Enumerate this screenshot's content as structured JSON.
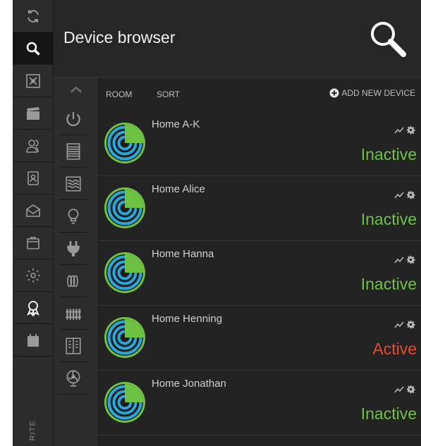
{
  "header": {
    "title": "Device browser"
  },
  "nav": {
    "items": [
      {
        "icon": "sync-icon"
      },
      {
        "icon": "search-icon",
        "active": true
      },
      {
        "icon": "crosshair-icon"
      },
      {
        "icon": "clapperboard-icon"
      },
      {
        "icon": "users-icon"
      },
      {
        "icon": "contacts-icon"
      },
      {
        "icon": "mail-icon"
      },
      {
        "icon": "folder-icon"
      },
      {
        "icon": "gear-icon"
      },
      {
        "icon": "award-icon"
      },
      {
        "icon": "calendar-icon"
      }
    ],
    "vertical_label": "RITE"
  },
  "categories": [
    {
      "icon": "chevron-up-icon"
    },
    {
      "icon": "power-icon"
    },
    {
      "icon": "blinds-icon"
    },
    {
      "icon": "heating-icon"
    },
    {
      "icon": "bulb-icon"
    },
    {
      "icon": "plug-icon"
    },
    {
      "icon": "coil-icon"
    },
    {
      "icon": "radiator-icon"
    },
    {
      "icon": "window-icon"
    },
    {
      "icon": "fan-icon"
    }
  ],
  "list": {
    "room_label": "ROOM",
    "sort_label": "SORT",
    "add_label": "ADD NEW DEVICE",
    "devices": [
      {
        "name": "Home A-K",
        "status": "Inactive",
        "status_color": "#6dc243"
      },
      {
        "name": "Home Alice",
        "status": "Inactive",
        "status_color": "#6dc243"
      },
      {
        "name": "Home Hanna",
        "status": "Inactive",
        "status_color": "#6dc243"
      },
      {
        "name": "Home Henning",
        "status": "Active",
        "status_color": "#e84a2a"
      },
      {
        "name": "Home Jonathan",
        "status": "Inactive",
        "status_color": "#6dc243"
      }
    ]
  },
  "colors": {
    "accent_green": "#6dc243",
    "accent_blue": "#2aa7d8",
    "active_red": "#e84a2a"
  }
}
